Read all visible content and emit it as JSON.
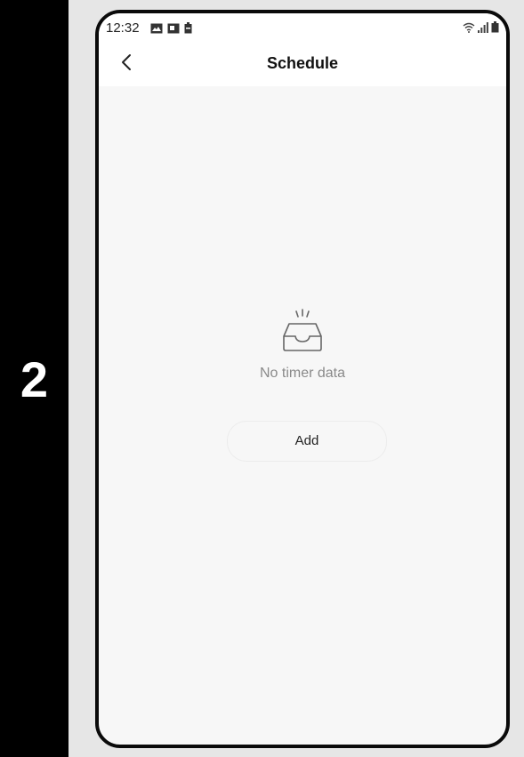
{
  "step": {
    "number": "2"
  },
  "status_bar": {
    "time": "12:32",
    "left_icons": [
      "image-icon",
      "picture-frame-icon",
      "battery-saver-icon"
    ],
    "right_icons": [
      "wifi-icon",
      "signal-icon",
      "battery-icon"
    ]
  },
  "header": {
    "back_icon": "chevron-left-icon",
    "title": "Schedule"
  },
  "empty_state": {
    "icon": "empty-inbox-icon",
    "message": "No timer data"
  },
  "actions": {
    "add_label": "Add"
  },
  "colors": {
    "band": "#000000",
    "screen_bg": "#f7f7f7",
    "header_bg": "#ffffff",
    "muted_text": "#8a8a8a"
  }
}
